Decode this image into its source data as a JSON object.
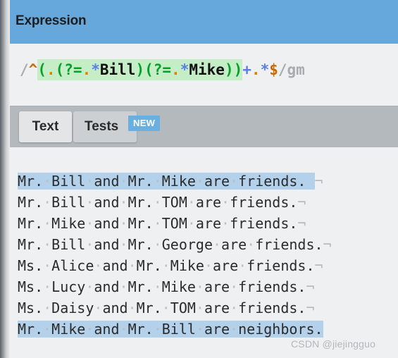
{
  "header": {
    "title": "Expression",
    "bg_color": "#66a7dc"
  },
  "expression": {
    "raw": "/^(.(?=.*Bill)(?=.*Mike))+.*$/gm",
    "delimiter_open": "/",
    "delimiter_close": "/",
    "flags": "gm",
    "highlight_color": "#c6eec6",
    "tokens": [
      {
        "t": "/",
        "k": "slash"
      },
      {
        "t": "^",
        "k": "anchor"
      },
      {
        "t": "(",
        "k": "group"
      },
      {
        "t": ".",
        "k": "dot"
      },
      {
        "t": "(?=",
        "k": "group"
      },
      {
        "t": ".",
        "k": "dot"
      },
      {
        "t": "*",
        "k": "quant"
      },
      {
        "t": "Bill",
        "k": "literal"
      },
      {
        "t": ")",
        "k": "group"
      },
      {
        "t": "(?=",
        "k": "group"
      },
      {
        "t": ".",
        "k": "dot"
      },
      {
        "t": "*",
        "k": "quant"
      },
      {
        "t": "Mike",
        "k": "literal"
      },
      {
        "t": ")",
        "k": "group"
      },
      {
        "t": ")",
        "k": "group"
      },
      {
        "t": "+",
        "k": "quant"
      },
      {
        "t": ".",
        "k": "dot"
      },
      {
        "t": "*",
        "k": "quant"
      },
      {
        "t": "$",
        "k": "anchor"
      },
      {
        "t": "/",
        "k": "slash"
      },
      {
        "t": "gm",
        "k": "flags"
      }
    ]
  },
  "tabs": {
    "items": [
      {
        "label": "Text",
        "active": true,
        "badge": null
      },
      {
        "label": "Tests",
        "active": false,
        "badge": "NEW"
      }
    ],
    "badge_color": "#69b0e0"
  },
  "test_text": {
    "space_glyph": "·",
    "newline_glyph": "¬",
    "match_color": "#b3d1ea",
    "lines": [
      {
        "text": "Mr. Bill and Mr. Mike are friends.",
        "matched": true,
        "newline": true
      },
      {
        "text": "Mr. Bill and Mr. TOM are friends.",
        "matched": false,
        "newline": true
      },
      {
        "text": "Mr. Mike and Mr. TOM are friends.",
        "matched": false,
        "newline": true
      },
      {
        "text": "Mr. Bill and Mr. George are friends.",
        "matched": false,
        "newline": true
      },
      {
        "text": "Ms. Alice and Mr. Mike are friends.",
        "matched": false,
        "newline": true
      },
      {
        "text": "Ms. Lucy and Mr. Mike are friends.",
        "matched": false,
        "newline": true
      },
      {
        "text": "Ms. Daisy and Mr. TOM are friends.",
        "matched": false,
        "newline": true
      },
      {
        "text": "Mr. Mike and Mr. Bill are neighbors.",
        "matched": true,
        "newline": false
      }
    ]
  },
  "watermark": {
    "text": "CSDN @jiejingguo"
  }
}
